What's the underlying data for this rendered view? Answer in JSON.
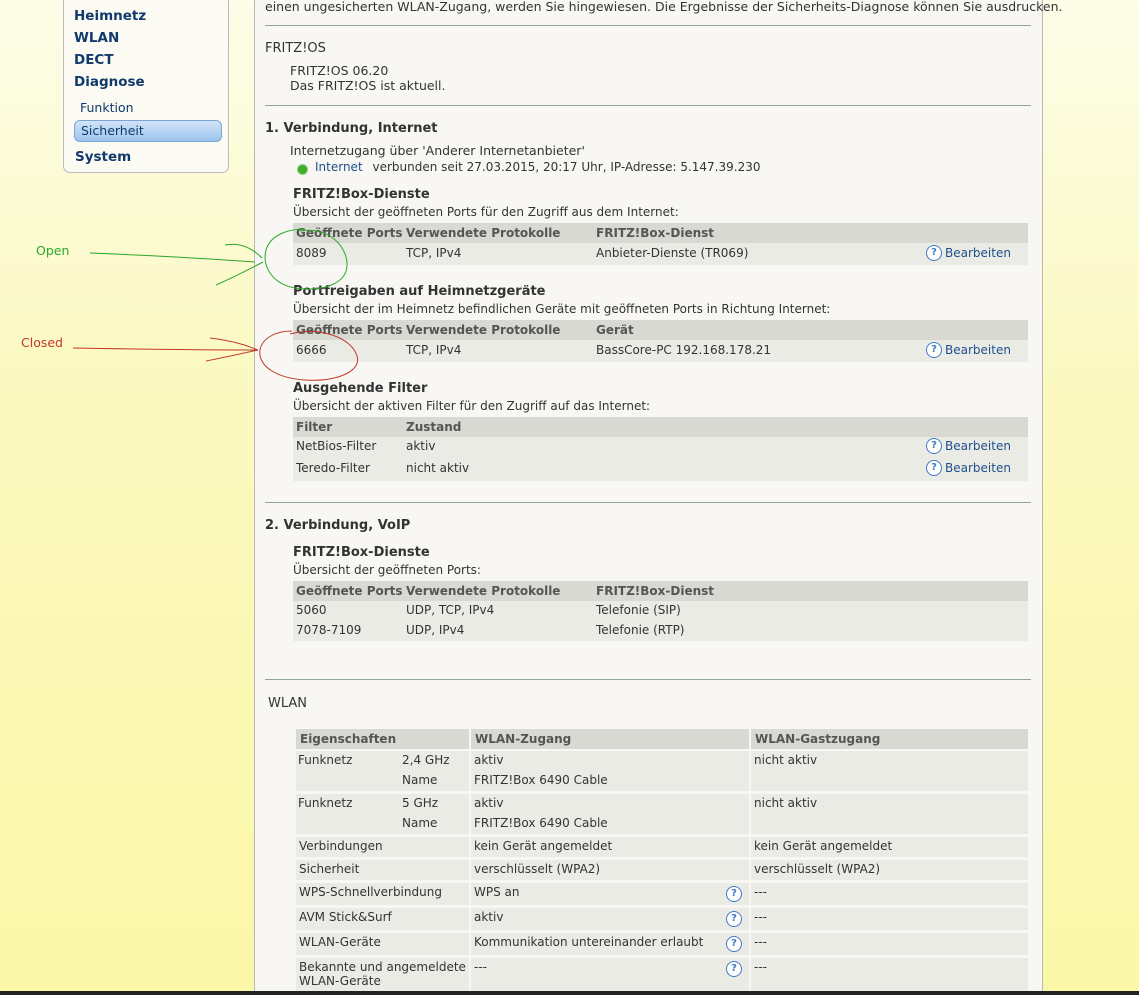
{
  "sidebar": {
    "items": [
      {
        "label": "Heimnetz"
      },
      {
        "label": "WLAN"
      },
      {
        "label": "DECT"
      },
      {
        "label": "Diagnose"
      },
      {
        "label": "Funktion"
      },
      {
        "label": "Sicherheit"
      },
      {
        "label": "System"
      }
    ]
  },
  "annotations": {
    "open": "Open",
    "closed": "Closed",
    "open_color": "#2aa82a",
    "closed_color": "#c0392b"
  },
  "intro": "einen ungesicherten WLAN-Zugang, werden Sie hingewiesen. Die Ergebnisse der Sicherheits-Diagnose können Sie ausdrucken.",
  "fritzos": {
    "title": "FRITZ!OS",
    "version": "FRITZ!OS 06.20",
    "status": "Das FRITZ!OS ist aktuell."
  },
  "internet": {
    "title": "1. Verbindung, Internet",
    "access": "Internetzugang über 'Anderer Internetanbieter'",
    "link_label": "Internet",
    "link_status": "verbunden seit 27.03.2015, 20:17 Uhr, IP-Adresse: 5.147.39.230",
    "status_color": "#3fae2c",
    "services": {
      "title": "FRITZ!Box-Dienste",
      "desc": "Übersicht der geöffneten Ports für den Zugriff aus dem Internet:",
      "headers": [
        "Geöffnete Ports",
        "Verwendete Protokolle",
        "FRITZ!Box-Dienst"
      ],
      "rows": [
        {
          "port": "8089",
          "proto": "TCP, IPv4",
          "service": "Anbieter-Dienste (TR069)",
          "action": "Bearbeiten"
        }
      ]
    },
    "forwards": {
      "title": "Portfreigaben auf Heimnetzgeräte",
      "desc": "Übersicht der im Heimnetz befindlichen Geräte mit geöffneten Ports in Richtung Internet:",
      "headers": [
        "Geöffnete Ports",
        "Verwendete Protokolle",
        "Gerät"
      ],
      "rows": [
        {
          "port": "6666",
          "proto": "TCP, IPv4",
          "device": "BassCore-PC 192.168.178.21",
          "action": "Bearbeiten"
        }
      ]
    },
    "filters": {
      "title": "Ausgehende Filter",
      "desc": "Übersicht der aktiven Filter für den Zugriff auf das Internet:",
      "headers": [
        "Filter",
        "Zustand"
      ],
      "rows": [
        {
          "name": "NetBios-Filter",
          "state": "aktiv",
          "action": "Bearbeiten"
        },
        {
          "name": "Teredo-Filter",
          "state": "nicht aktiv",
          "action": "Bearbeiten"
        }
      ]
    }
  },
  "voip": {
    "title": "2. Verbindung, VoIP",
    "services": {
      "title": "FRITZ!Box-Dienste",
      "desc": "Übersicht der geöffneten Ports:",
      "headers": [
        "Geöffnete Ports",
        "Verwendete Protokolle",
        "FRITZ!Box-Dienst"
      ],
      "rows": [
        {
          "port": "5060",
          "proto": "UDP, TCP, IPv4",
          "service": "Telefonie (SIP)"
        },
        {
          "port": "7078-7109",
          "proto": "UDP, IPv4",
          "service": "Telefonie (RTP)"
        }
      ]
    }
  },
  "wlan": {
    "title": "WLAN",
    "headers": [
      "Eigenschaften",
      "WLAN-Zugang",
      "WLAN-Gastzugang"
    ],
    "funk24": {
      "label": "Funknetz",
      "band": "2,4 GHz",
      "name_label": "Name",
      "state": "aktiv",
      "ssid": "FRITZ!Box 6490 Cable",
      "guest": "nicht aktiv"
    },
    "funk5": {
      "label": "Funknetz",
      "band": "5 GHz",
      "name_label": "Name",
      "state": "aktiv",
      "ssid": "FRITZ!Box 6490 Cable",
      "guest": "nicht aktiv"
    },
    "rows": [
      {
        "label": "Verbindungen",
        "access": "kein Gerät angemeldet",
        "guest": "kein Gerät angemeldet"
      },
      {
        "label": "Sicherheit",
        "access": "verschlüsselt (WPA2)",
        "guest": "verschlüsselt (WPA2)"
      },
      {
        "label": "WPS-Schnellverbindung",
        "access": "WPS an",
        "guest": "---"
      },
      {
        "label": "AVM Stick&Surf",
        "access": "aktiv",
        "guest": "---"
      },
      {
        "label": "WLAN-Geräte",
        "access": "Kommunikation untereinander erlaubt",
        "guest": "---"
      },
      {
        "label": "Bekannte und angemeldete",
        "label2": "WLAN-Geräte",
        "access": "---",
        "guest": "---"
      }
    ]
  }
}
